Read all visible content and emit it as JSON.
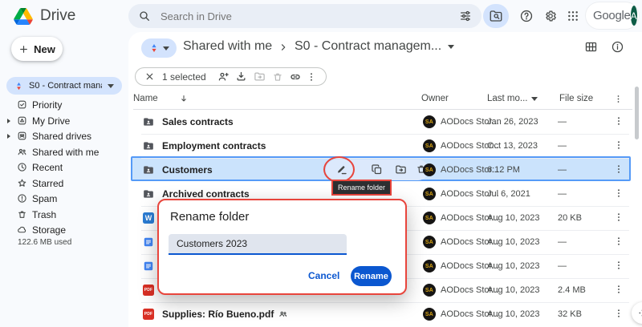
{
  "topbar": {
    "app_name": "Drive",
    "search_placeholder": "Search in Drive",
    "google_wordmark": "Google",
    "avatar_initial": "A"
  },
  "sidebar": {
    "new_button_label": "New",
    "workspace_selector": "S0 - Contract mana...",
    "items": [
      {
        "label": "Priority"
      },
      {
        "label": "My Drive"
      },
      {
        "label": "Shared drives"
      },
      {
        "label": "Shared with me"
      },
      {
        "label": "Recent"
      },
      {
        "label": "Starred"
      },
      {
        "label": "Spam"
      },
      {
        "label": "Trash"
      },
      {
        "label": "Storage"
      }
    ],
    "storage_used": "122.6 MB used"
  },
  "breadcrumb": {
    "parent": "Shared with me",
    "current": "S0 - Contract managem..."
  },
  "toolbar": {
    "selected_count": "1 selected"
  },
  "table": {
    "headers": {
      "name": "Name",
      "owner": "Owner",
      "modified": "Last mo...",
      "size": "File size"
    },
    "owner_initials": "SA",
    "rows": [
      {
        "name": "Sales contracts",
        "owner": "AODocs Stor...",
        "modified": "Jan 26, 2023",
        "size": "—"
      },
      {
        "name": "Employment contracts",
        "owner": "AODocs Stor...",
        "modified": "Oct 13, 2023",
        "size": "—"
      },
      {
        "name": "Customers",
        "owner": "AODocs Stor...",
        "modified": "6:12 PM",
        "size": "—"
      },
      {
        "name": "Archived contracts",
        "owner": "AODocs Stor...",
        "modified": "Jul 6, 2021",
        "size": "—"
      },
      {
        "owner": "AODocs Stor...",
        "modified": "Aug 10, 2023",
        "size": "20 KB"
      },
      {
        "owner": "AODocs Stor...",
        "modified": "Aug 10, 2023",
        "size": "—"
      },
      {
        "owner": "AODocs Stor...",
        "modified": "Aug 10, 2023",
        "size": "—"
      },
      {
        "owner": "AODocs Stor...",
        "modified": "Aug 10, 2023",
        "size": "2.4 MB"
      },
      {
        "name": "Supplies: Río Bueno.pdf",
        "owner": "AODocs Stor...",
        "modified": "Aug 10, 2023",
        "size": "32 KB"
      }
    ]
  },
  "row_actions": {
    "rename_tooltip": "Rename folder"
  },
  "dialog": {
    "title": "Rename folder",
    "input_value": "Customers 2023",
    "cancel_label": "Cancel",
    "confirm_label": "Rename"
  },
  "colors": {
    "accent_blue": "#0b57d0",
    "selection_fill": "#cbe3fc",
    "selection_border": "#559af7",
    "annotation_red": "#e8453c",
    "pill_blue": "#d3e3fd",
    "search_bar": "#e9eef6",
    "avatar_gold": "#d9a514"
  }
}
